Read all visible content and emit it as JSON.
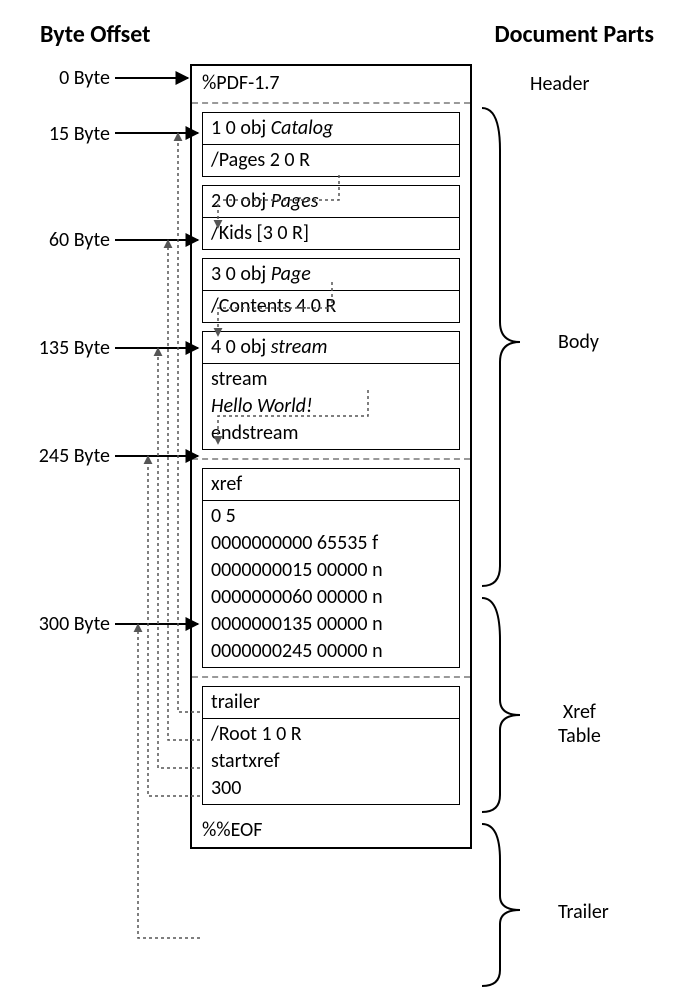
{
  "titles": {
    "left": "Byte Offset",
    "right": "Document Parts"
  },
  "offsets": {
    "b0": "0 Byte",
    "b15": "15 Byte",
    "b60": "60 Byte",
    "b135": "135 Byte",
    "b245": "245 Byte",
    "b300": "300 Byte"
  },
  "header": {
    "line": "%PDF-1.7"
  },
  "obj1": {
    "head_fixed": "1 0 obj ",
    "head_italic": "Catalog",
    "body": "/Pages 2 0 R"
  },
  "obj2": {
    "head_fixed": "2 0 obj ",
    "head_italic": "Pages",
    "body": "/Kids [3 0 R]"
  },
  "obj3": {
    "head_fixed": "3 0 obj ",
    "head_italic": "Page",
    "body": "/Contents 4 0 R"
  },
  "obj4": {
    "head_fixed": "4 0 obj ",
    "head_italic": "stream",
    "body1": "stream",
    "body2": "Hello World!",
    "body3": "endstream"
  },
  "xref": {
    "title": "xref",
    "l0": "0 5",
    "l1": "0000000000 65535 f",
    "l2": "0000000015 00000 n",
    "l3": "0000000060 00000 n",
    "l4": "0000000135 00000 n",
    "l5": "0000000245 00000 n"
  },
  "trailer": {
    "title": "trailer",
    "l1": "/Root 1 0 R",
    "l2": "startxref",
    "l3": "300"
  },
  "eof": "%%EOF",
  "parts": {
    "header": "Header",
    "body": "Body",
    "xref": "Xref\nTable",
    "trailer": "Trailer"
  }
}
